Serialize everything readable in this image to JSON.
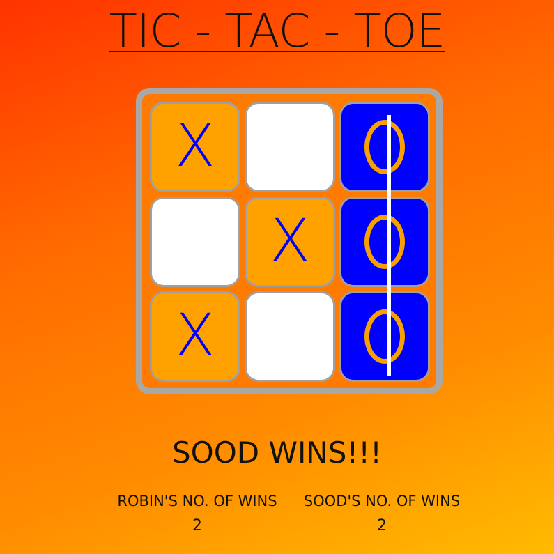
{
  "title": "TIC - TAC - TOE",
  "board": {
    "cells": [
      "X",
      "",
      "O",
      "",
      "X",
      "O",
      "X",
      "",
      "O"
    ],
    "winning_line": "column-3"
  },
  "status": "SOOD WINS!!!",
  "scores": [
    {
      "label": "ROBIN'S NO. OF WINS",
      "value": "2"
    },
    {
      "label": "SOOD'S NO. OF WINS",
      "value": "2"
    }
  ],
  "colors": {
    "x_cell": "#ffa200",
    "x_mark": "#0000ff",
    "o_cell": "#0000ff",
    "o_mark": "#f7a000",
    "empty_cell": "#ffffff",
    "board_border": "#a8a8a8",
    "win_line": "#ffffff"
  }
}
